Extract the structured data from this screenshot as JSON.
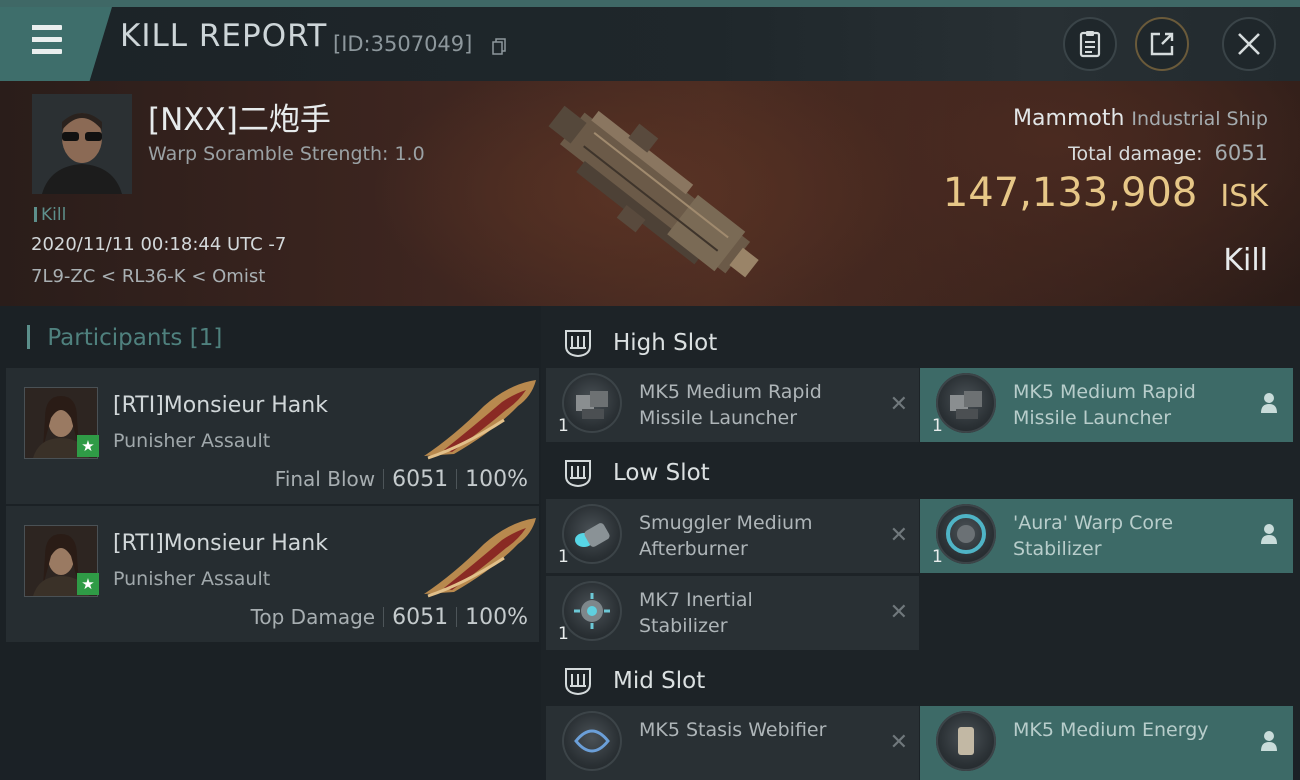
{
  "header": {
    "title": "KILL REPORT",
    "kill_id": "[ID:3507049]",
    "icons": [
      "menu-icon",
      "copy-icon",
      "clipboard-icon",
      "share-icon",
      "close-icon"
    ]
  },
  "victim": {
    "name": "[NXX]二炮手",
    "warp_scramble": "Warp Soramble Strength: 1.0",
    "tag": "Kill",
    "datetime": "2020/11/11 00:18:44 UTC -7",
    "location": "7L9-ZC < RL36-K < Omist",
    "ship_name": "Mammoth",
    "ship_class": "Industrial Ship",
    "total_damage_label": "Total damage:",
    "total_damage": "6051",
    "isk_value": "147,133,908",
    "isk_unit": "ISK",
    "result": "Kill"
  },
  "participants": {
    "title": "Participants",
    "count": "[1]",
    "rows": [
      {
        "name": "[RTI]Monsieur Hank",
        "ship": "Punisher Assault",
        "role": "Final Blow",
        "damage": "6051",
        "percent": "100%"
      },
      {
        "name": "[RTI]Monsieur Hank",
        "ship": "Punisher Assault",
        "role": "Top Damage",
        "damage": "6051",
        "percent": "100%"
      }
    ]
  },
  "fitting": {
    "high_slot": {
      "label": "High Slot",
      "items": [
        {
          "line1": "MK5 Medium Rapid",
          "line2": "Missile Launcher",
          "qty": "1",
          "status": "destroyed"
        },
        {
          "line1": "MK5 Medium Rapid",
          "line2": "Missile Launcher",
          "qty": "1",
          "status": "dropped"
        }
      ]
    },
    "low_slot": {
      "label": "Low Slot",
      "items": [
        {
          "line1": "Smuggler Medium",
          "line2": "Afterburner",
          "qty": "1",
          "status": "destroyed"
        },
        {
          "line1": "'Aura' Warp Core",
          "line2": "Stabilizer",
          "qty": "1",
          "status": "dropped"
        },
        {
          "line1": "MK7 Inertial",
          "line2": "Stabilizer",
          "qty": "1",
          "status": "destroyed"
        }
      ]
    },
    "mid_slot": {
      "label": "Mid Slot",
      "items": [
        {
          "line1": "MK5 Stasis Webifier",
          "line2": "",
          "qty": "1",
          "status": "destroyed"
        },
        {
          "line1": "MK5 Medium Energy",
          "line2": "",
          "qty": "1",
          "status": "dropped"
        }
      ]
    }
  },
  "colors": {
    "accent_teal": "#3e6e6b",
    "isk_gold": "#e7c787",
    "star_green": "#2f9b46"
  }
}
